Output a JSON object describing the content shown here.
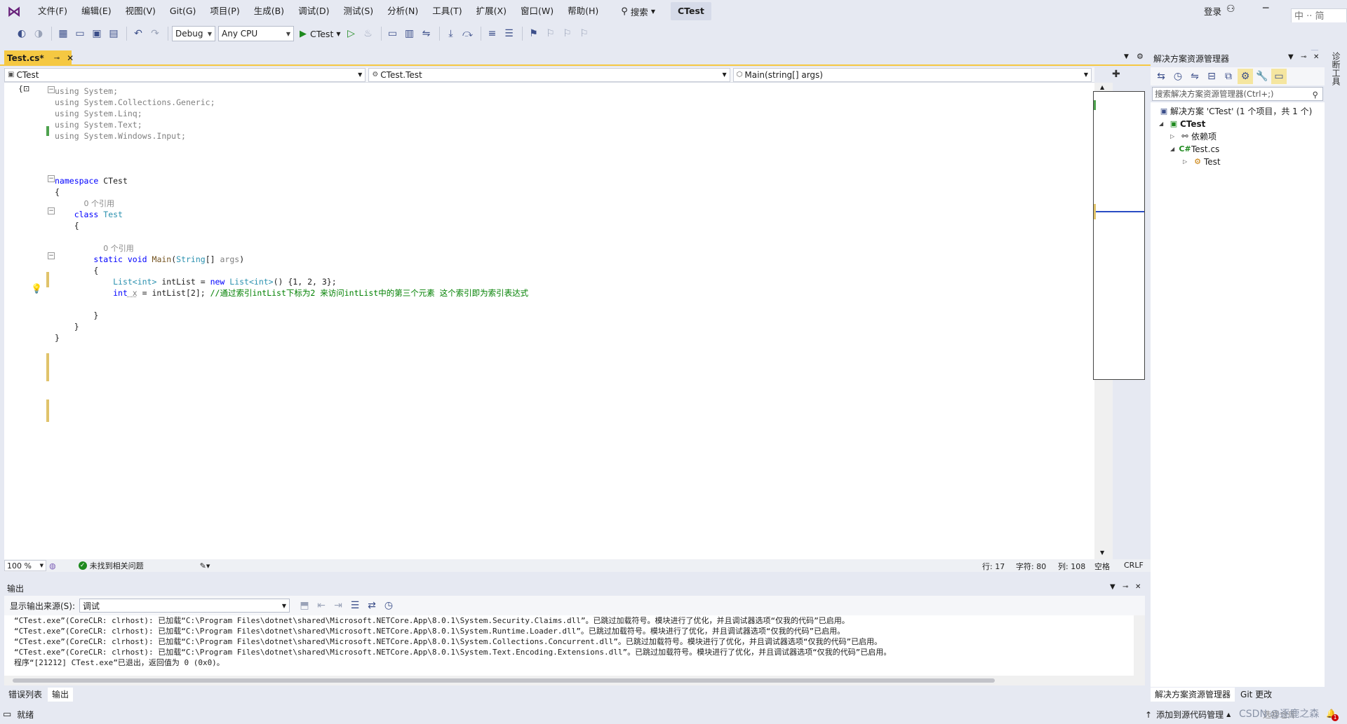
{
  "titlebar": {
    "menus": [
      "文件(F)",
      "编辑(E)",
      "视图(V)",
      "Git(G)",
      "项目(P)",
      "生成(B)",
      "调试(D)",
      "测试(S)",
      "分析(N)",
      "工具(T)",
      "扩展(X)",
      "窗口(W)",
      "帮助(H)"
    ],
    "search_label": "搜索",
    "solution_name": "CTest",
    "login_label": "登录",
    "ime_text": "中 ·· 简"
  },
  "toolbar": {
    "config": "Debug",
    "platform": "Any CPU",
    "run_target": "CTest"
  },
  "editor": {
    "tab_label": "Test.cs*",
    "nav_project": "CTest",
    "nav_type": "CTest.Test",
    "nav_member": "Main(string[] args)",
    "zoom": "100 %",
    "issues": "未找到相关问题",
    "pos_line": "行: 17",
    "pos_char": "字符: 80",
    "pos_col": "列: 108",
    "pos_space": "空格",
    "pos_eol": "CRLF",
    "lens_refs": "0 个引用"
  },
  "code": {
    "using1_ns": "System;",
    "using2_ns": "System.Collections.Generic;",
    "using3_ns": "System.Linq;",
    "using4_ns": "System.Text;",
    "using5_ns": "System.Windows.Input;",
    "kw_using": "using",
    "kw_namespace": "namespace",
    "ns_name": "CTest",
    "brace_open": "{",
    "brace_close": "}",
    "kw_class": "class",
    "class_name": "Test",
    "kw_static": "static",
    "kw_void": "void",
    "method_name": "Main",
    "param_open": "(",
    "param_type": "String",
    "param_rest": "[] ",
    "param_name": "args",
    "param_close": ")",
    "l13_type": "List<int>",
    "l13_var": " intList = ",
    "l13_new": "new",
    "l13_type2": " List<int>",
    "l13_rest": "() {1, 2, 3};",
    "l14_int": "int",
    "l14_var": " x",
    "l14_rest": " = intList[2]; ",
    "l14_comment": "//通过索引intList下标为2 来访问intList中的第三个元素 这个索引即为索引表达式"
  },
  "output": {
    "title": "输出",
    "source_label": "显示输出来源(S):",
    "source_value": "调试",
    "lines": [
      "“CTest.exe”(CoreCLR: clrhost): 已加载“C:\\Program Files\\dotnet\\shared\\Microsoft.NETCore.App\\8.0.1\\System.Security.Claims.dll”。已跳过加载符号。模块进行了优化，并且调试器选项“仅我的代码”已启用。",
      "“CTest.exe”(CoreCLR: clrhost): 已加载“C:\\Program Files\\dotnet\\shared\\Microsoft.NETCore.App\\8.0.1\\System.Runtime.Loader.dll”。已跳过加载符号。模块进行了优化，并且调试器选项“仅我的代码”已启用。",
      "“CTest.exe”(CoreCLR: clrhost): 已加载“C:\\Program Files\\dotnet\\shared\\Microsoft.NETCore.App\\8.0.1\\System.Collections.Concurrent.dll”。已跳过加载符号。模块进行了优化，并且调试器选项“仅我的代码”已启用。",
      "“CTest.exe”(CoreCLR: clrhost): 已加载“C:\\Program Files\\dotnet\\shared\\Microsoft.NETCore.App\\8.0.1\\System.Text.Encoding.Extensions.dll”。已跳过加载符号。模块进行了优化，并且调试器选项“仅我的代码”已启用。",
      "程序“[21212] CTest.exe”已退出，返回值为 0 (0x0)。"
    ],
    "tabs": [
      "错误列表",
      "输出"
    ]
  },
  "solution_explorer": {
    "title": "解决方案资源管理器",
    "search_placeholder": "搜索解决方案资源管理器(Ctrl+;)",
    "solution_node": "解决方案 'CTest' (1 个项目，共 1 个)",
    "project_node": "CTest",
    "deps_node": "依赖项",
    "file_node": "Test.cs",
    "class_node": "Test",
    "tabs": [
      "解决方案资源管理器",
      "Git 更改"
    ]
  },
  "right_rail_label": "诊断工具",
  "statusbar": {
    "ready": "就绪",
    "source_control": "添加到源代码管理",
    "repo": "选择仓库",
    "watermark": "CSDN @逐鹿之森",
    "notif_count": "1"
  }
}
